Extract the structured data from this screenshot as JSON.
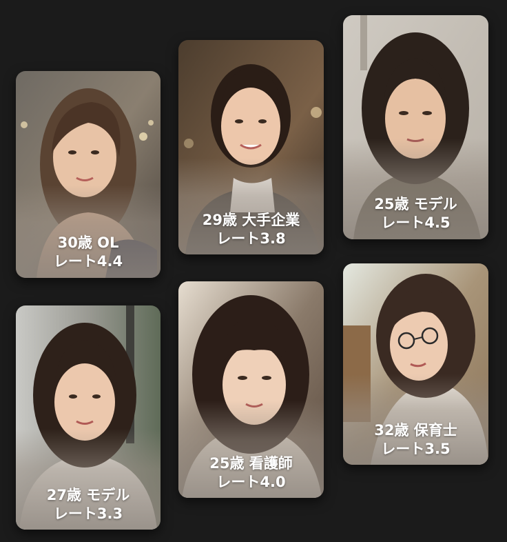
{
  "profiles": [
    {
      "line1": "30歳 OL",
      "line2": "レート4.4"
    },
    {
      "line1": "29歳 大手企業",
      "line2": "レート3.8"
    },
    {
      "line1": "25歳 モデル",
      "line2": "レート4.5"
    },
    {
      "line1": "27歳 モデル",
      "line2": "レート3.3"
    },
    {
      "line1": "25歳 看護師",
      "line2": "レート4.0"
    },
    {
      "line1": "32歳 保育士",
      "line2": "レート3.5"
    }
  ]
}
